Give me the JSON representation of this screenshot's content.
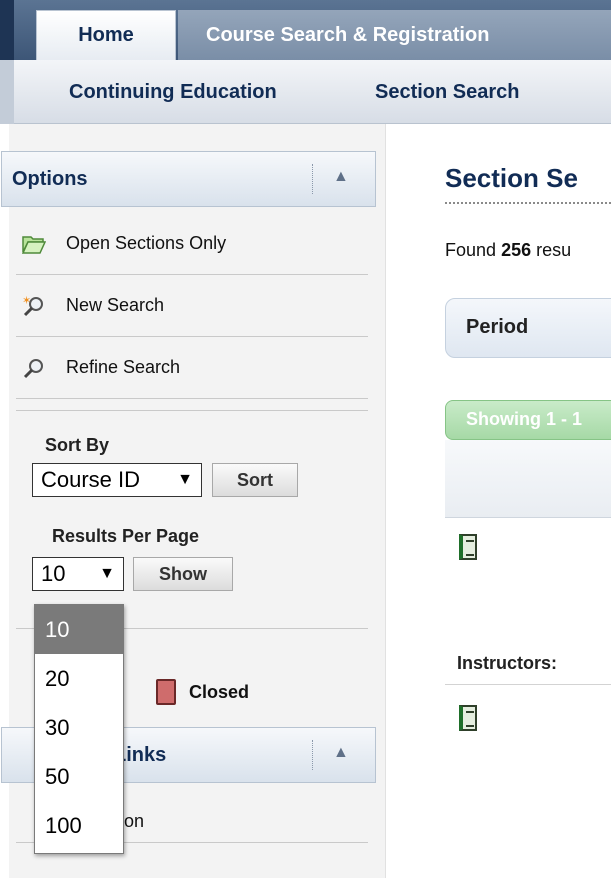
{
  "tabs": [
    {
      "label": "Home",
      "active": true
    },
    {
      "label": "Course Search & Registration",
      "active": false
    }
  ],
  "subnav": [
    "Continuing Education",
    "Section Search"
  ],
  "options": {
    "title": "Options",
    "items": [
      {
        "label": "Open Sections Only",
        "icon": "folder-open-icon"
      },
      {
        "label": "New Search",
        "icon": "new-search-icon"
      },
      {
        "label": "Refine Search",
        "icon": "magnifier-icon"
      }
    ],
    "sort_by_label": "Sort By",
    "sort_by_value": "Course ID",
    "sort_button": "Sort",
    "results_per_page_label": "Results Per Page",
    "results_per_page_value": "10",
    "show_button": "Show",
    "legend_closed": "Closed"
  },
  "results_dropdown": {
    "options": [
      "10",
      "20",
      "30",
      "50",
      "100"
    ],
    "selected": "10"
  },
  "links_panel": {
    "title": "Links",
    "item_fragment": "ion"
  },
  "main": {
    "title": "Section Se",
    "found_prefix": "Found",
    "found_count": "256",
    "found_suffix": "resu",
    "period_header": "Period",
    "showing_text": "Showing 1 - 1",
    "instructors_label": "Instructors:"
  },
  "colors": {
    "nav_dark": "#3d5677",
    "brand_text": "#112c55",
    "showing_green": "#a6d9a6",
    "closed_red": "#cf6c6c"
  }
}
